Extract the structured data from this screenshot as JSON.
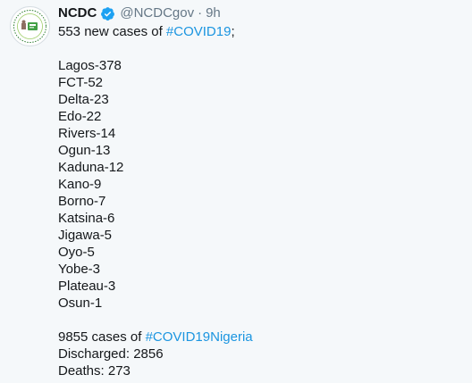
{
  "author": {
    "name": "NCDC",
    "handle": "@NCDCgov",
    "separator": "·",
    "time": "9h",
    "verified": true,
    "avatar_icon": "ncdc-logo-avatar"
  },
  "intro": {
    "prefix": "553 new cases of ",
    "hashtag": "#COVID19",
    "suffix": ";"
  },
  "states": [
    "Lagos-378",
    "FCT-52",
    "Delta-23",
    "Edo-22",
    "Rivers-14",
    "Ogun-13",
    "Kaduna-12",
    "Kano-9",
    "Borno-7",
    "Katsina-6",
    "Jigawa-5",
    "Oyo-5",
    "Yobe-3",
    "Plateau-3",
    "Osun-1"
  ],
  "summary": {
    "cases_prefix": "9855 cases of ",
    "cases_hashtag": "#COVID19Nigeria",
    "discharged": "Discharged: 2856",
    "deaths": "Deaths: 273"
  },
  "colors": {
    "hashtag": "#1b95e0",
    "verified_badge": "#1da1f2",
    "muted_text": "#657786",
    "background": "#f5f8fa"
  }
}
